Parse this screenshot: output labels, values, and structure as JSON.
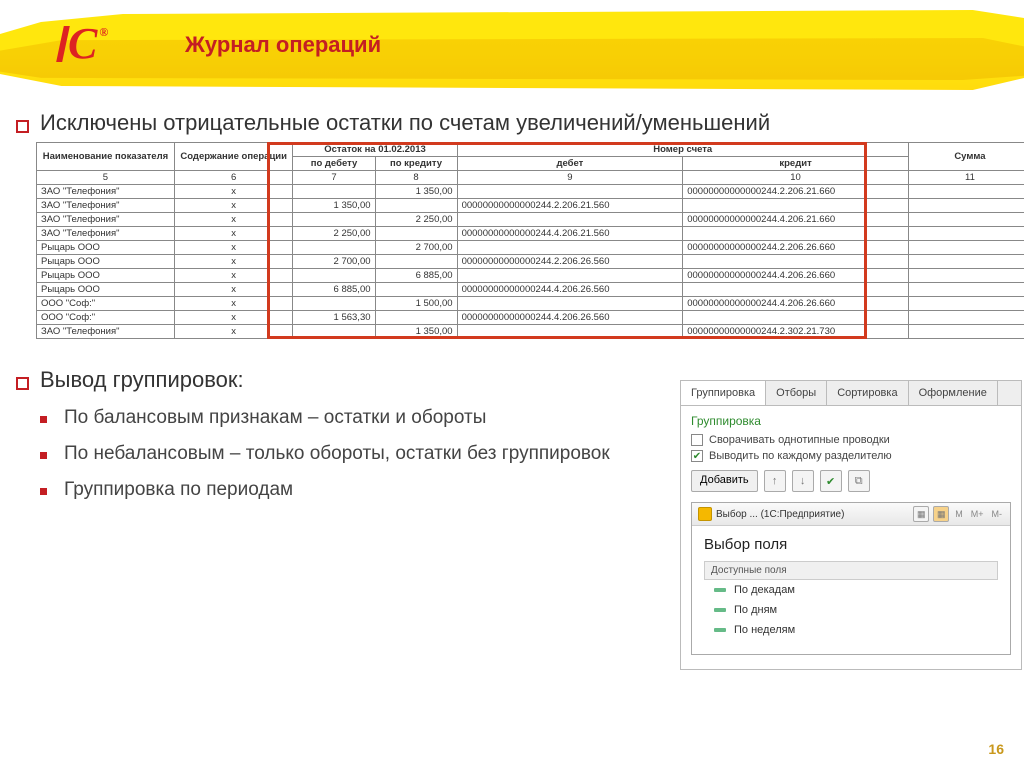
{
  "header": {
    "title": "Журнал операций"
  },
  "bullets": {
    "b1": "Исключены отрицательные остатки по счетам увеличений/уменьшений",
    "b2": "Вывод группировок:",
    "s1": "По балансовым признакам – остатки и обороты",
    "s2": "По небалансовым – только обороты, остатки без группировок",
    "s3": "Группировка по периодам"
  },
  "table": {
    "ostatok_title": "Остаток на 01.02.2013",
    "nomer_title": "Номер счета",
    "h_name": "Наименование показателя",
    "h_op": "Содержание операции",
    "h_deb": "по дебету",
    "h_kred": "по кредиту",
    "h_debet": "дебет",
    "h_kredit": "кредит",
    "h_sum": "Сумма",
    "col5": "5",
    "col6": "6",
    "col7": "7",
    "col8": "8",
    "col9": "9",
    "col10": "10",
    "col11": "11",
    "rows": [
      {
        "n": "ЗАО \"Телефония\"",
        "op": "x",
        "d": "",
        "k": "1 350,00",
        "deb": "",
        "kre": "00000000000000244.2.206.21.660"
      },
      {
        "n": "ЗАО \"Телефония\"",
        "op": "x",
        "d": "1 350,00",
        "k": "",
        "deb": "00000000000000244.2.206.21.560",
        "kre": ""
      },
      {
        "n": "ЗАО \"Телефония\"",
        "op": "x",
        "d": "",
        "k": "2 250,00",
        "deb": "",
        "kre": "00000000000000244.4.206.21.660"
      },
      {
        "n": "ЗАО \"Телефония\"",
        "op": "x",
        "d": "2 250,00",
        "k": "",
        "deb": "00000000000000244.4.206.21.560",
        "kre": ""
      },
      {
        "n": "Рыцарь ООО",
        "op": "x",
        "d": "",
        "k": "2 700,00",
        "deb": "",
        "kre": "00000000000000244.2.206.26.660"
      },
      {
        "n": "Рыцарь ООО",
        "op": "x",
        "d": "2 700,00",
        "k": "",
        "deb": "00000000000000244.2.206.26.560",
        "kre": ""
      },
      {
        "n": "Рыцарь ООО",
        "op": "x",
        "d": "",
        "k": "6 885,00",
        "deb": "",
        "kre": "00000000000000244.4.206.26.660"
      },
      {
        "n": "Рыцарь ООО",
        "op": "x",
        "d": "6 885,00",
        "k": "",
        "deb": "00000000000000244.4.206.26.560",
        "kre": ""
      },
      {
        "n": "ООО \"Соф:\"",
        "op": "x",
        "d": "",
        "k": "1 500,00",
        "deb": "",
        "kre": "00000000000000244.4.206.26.660"
      },
      {
        "n": "ООО \"Соф:\"",
        "op": "x",
        "d": "1 563,30",
        "k": "",
        "deb": "00000000000000244.4.206.26.560",
        "kre": ""
      },
      {
        "n": "ЗАО \"Телефония\"",
        "op": "x",
        "d": "",
        "k": "1 350,00",
        "deb": "",
        "kre": "00000000000000244.2.302.21.730"
      }
    ]
  },
  "panel": {
    "tabs": [
      "Группировка",
      "Отборы",
      "Сортировка",
      "Оформление"
    ],
    "heading": "Группировка",
    "chk1": "Сворачивать однотипные проводки",
    "chk2": "Выводить по каждому разделителю",
    "add": "Добавить"
  },
  "popup": {
    "title": "Выбор ... (1С:Предприятие)",
    "heading": "Выбор поля",
    "fields_head": "Доступные поля",
    "m": "M",
    "mp": "M+",
    "mm": "M-",
    "items": [
      "По декадам",
      "По дням",
      "По неделям"
    ]
  },
  "page_number": "16"
}
